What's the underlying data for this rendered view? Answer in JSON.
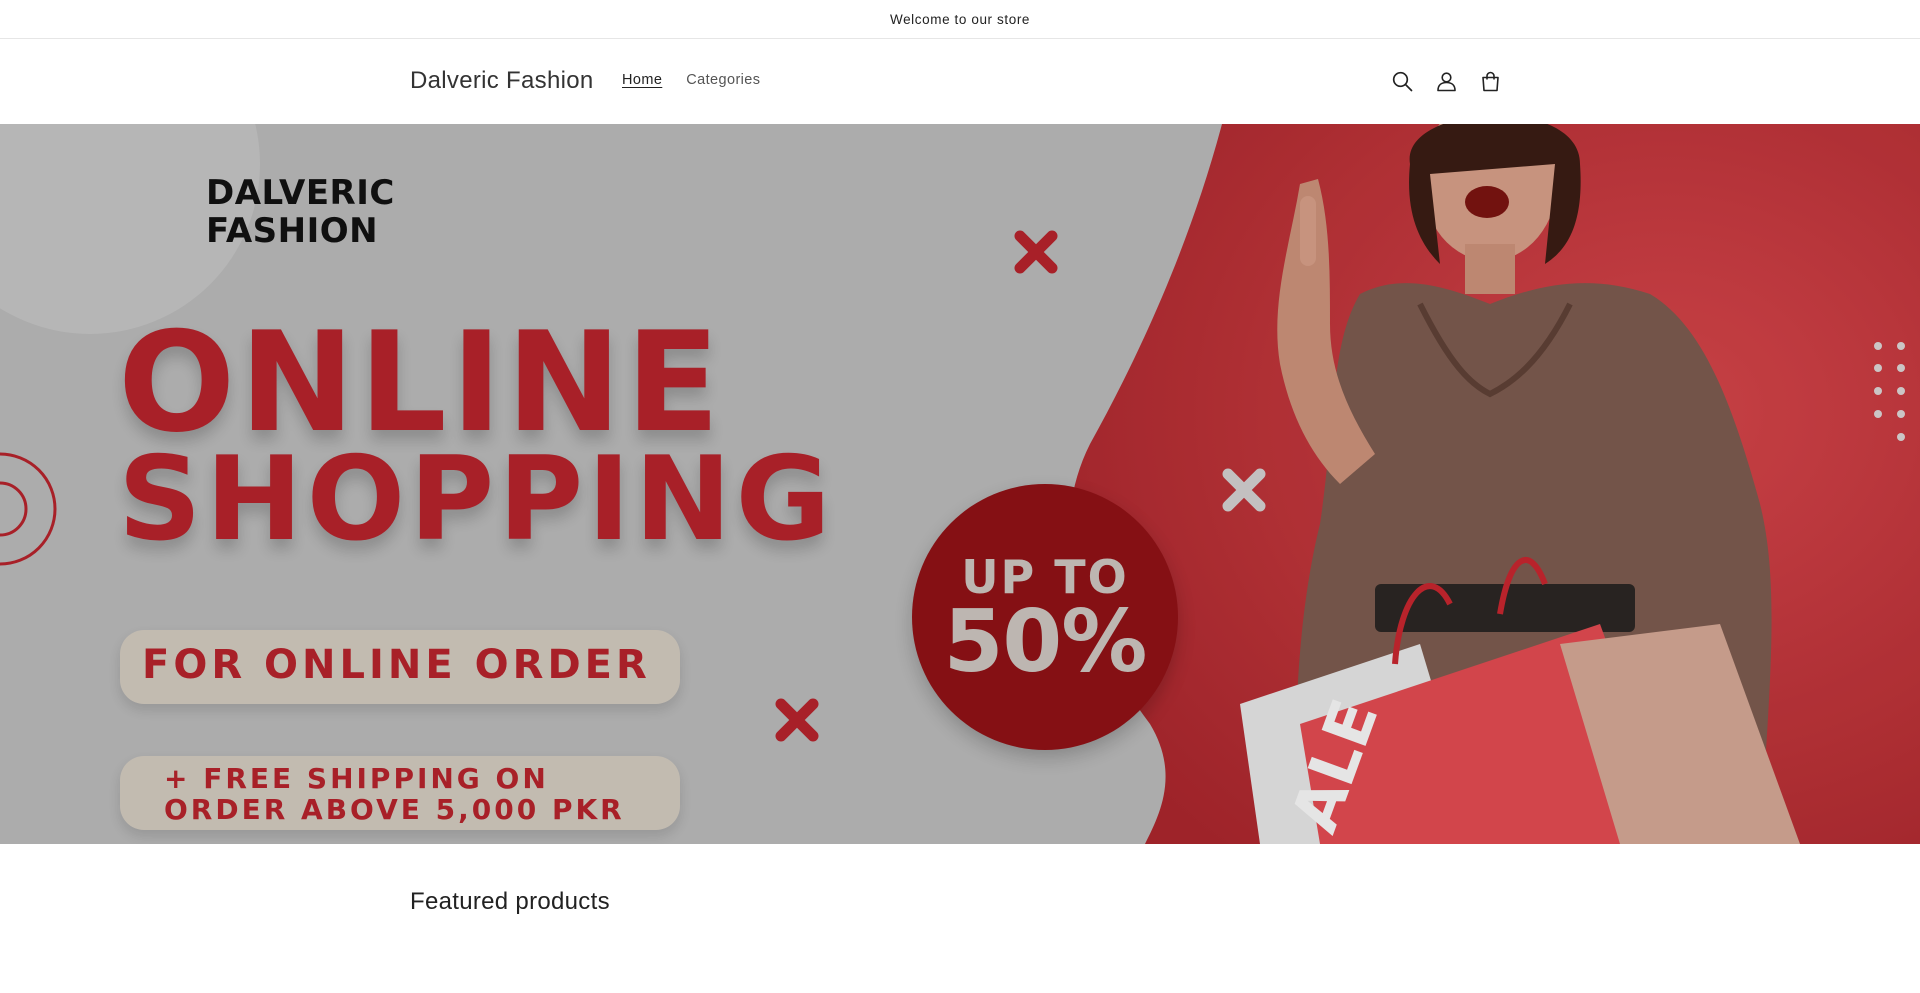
{
  "announcement": {
    "text": "Welcome to our store"
  },
  "header": {
    "brand": "Dalveric Fashion",
    "nav": [
      {
        "label": "Home",
        "active": true
      },
      {
        "label": "Categories",
        "active": false
      }
    ],
    "icons": [
      "search-icon",
      "account-icon",
      "cart-icon"
    ]
  },
  "hero": {
    "logo_line1": "DALVERIC",
    "logo_line2": "FASHION",
    "headline_line1": "ONLINE",
    "headline_line2": "SHOPPING",
    "pill1": "FOR ONLINE ORDER",
    "pill2_line1": "+ FREE SHIPPING ON",
    "pill2_line2": "ORDER ABOVE 5,000 PKR",
    "badge_line1": "UP TO",
    "badge_line2": "50%",
    "bag_text": "ALE",
    "colors": {
      "accent": "#b3232b",
      "badge": "#8e1216",
      "background_left": "#b8b8b8",
      "background_right": "#c4373d"
    }
  },
  "featured": {
    "title": "Featured products"
  }
}
